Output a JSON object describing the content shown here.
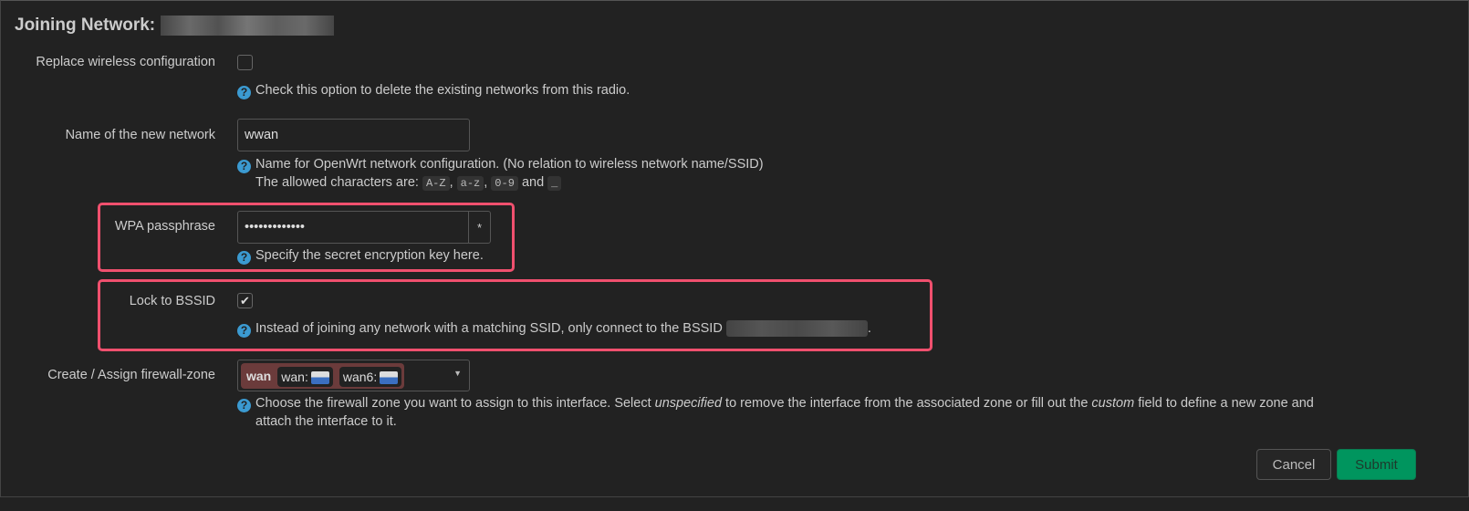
{
  "title": "Joining Network:",
  "replace": {
    "label": "Replace wireless configuration",
    "checked": false,
    "help": "Check this option to delete the existing networks from this radio."
  },
  "name": {
    "label": "Name of the new network",
    "value": "wwan",
    "help1": "Name for OpenWrt network configuration. (No relation to wireless network name/SSID)",
    "help2_prefix": "The allowed characters are:",
    "codes": [
      "A-Z",
      "a-z",
      "0-9",
      "_"
    ],
    "and": "and"
  },
  "wpa": {
    "label": "WPA passphrase",
    "value": "•••••••••••••",
    "reveal": "*",
    "help": "Specify the secret encryption key here."
  },
  "bssid": {
    "label": "Lock to BSSID",
    "checked": true,
    "help": "Instead of joining any network with a matching SSID, only connect to the BSSID"
  },
  "zone": {
    "label": "Create / Assign firewall-zone",
    "zone_name": "wan",
    "chips": [
      "wan:",
      "wan6:"
    ],
    "help_a": "Choose the firewall zone you want to assign to this interface. Select ",
    "help_em1": "unspecified",
    "help_b": " to remove the interface from the associated zone or fill out the ",
    "help_em2": "custom",
    "help_c": " field to define a new zone and",
    "help_d": "attach the interface to it.",
    "zone_color": "#6b3b3b"
  },
  "buttons": {
    "cancel": "Cancel",
    "submit": "Submit"
  },
  "colors": {
    "highlight": "#f0506e",
    "submit": "#00955e",
    "help_icon": "#3b9ad1"
  }
}
